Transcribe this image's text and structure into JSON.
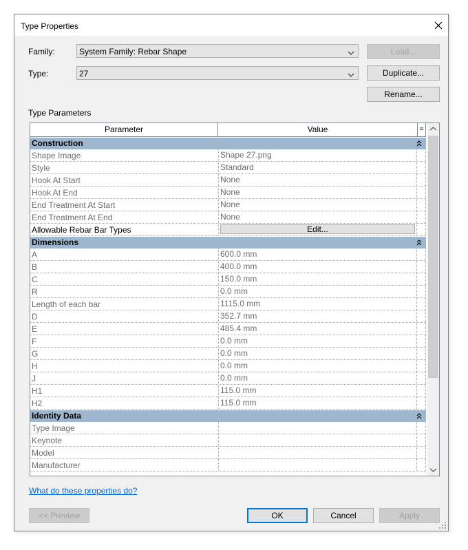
{
  "dialog": {
    "title": "Type Properties"
  },
  "family": {
    "label": "Family:",
    "value": "System Family: Rebar Shape"
  },
  "type": {
    "label": "Type:",
    "value": "27"
  },
  "buttons": {
    "load": "Load...",
    "duplicate": "Duplicate...",
    "rename": "Rename...",
    "preview": "<< Preview",
    "ok": "OK",
    "cancel": "Cancel",
    "apply": "Apply"
  },
  "section_label": "Type Parameters",
  "table": {
    "headers": {
      "parameter": "Parameter",
      "value": "Value",
      "eq": "="
    },
    "groups": [
      {
        "name": "Construction",
        "rows": [
          {
            "parameter": "Shape Image",
            "value": "Shape 27.png"
          },
          {
            "parameter": "Style",
            "value": "Standard"
          },
          {
            "parameter": "Hook At Start",
            "value": "None"
          },
          {
            "parameter": "Hook At End",
            "value": "None"
          },
          {
            "parameter": "End Treatment At Start",
            "value": "None"
          },
          {
            "parameter": "End Treatment At End",
            "value": "None"
          },
          {
            "parameter": "Allowable Rebar Bar Types",
            "value": "Edit...",
            "button": true
          }
        ]
      },
      {
        "name": "Dimensions",
        "rows": [
          {
            "parameter": "A",
            "value": "600.0 mm"
          },
          {
            "parameter": "B",
            "value": "400.0 mm"
          },
          {
            "parameter": "C",
            "value": "150.0 mm"
          },
          {
            "parameter": "R",
            "value": "0.0 mm"
          },
          {
            "parameter": "Length of each bar",
            "value": "1115.0 mm"
          },
          {
            "parameter": "D",
            "value": "352.7 mm"
          },
          {
            "parameter": "E",
            "value": "485.4 mm"
          },
          {
            "parameter": "F",
            "value": "0.0 mm"
          },
          {
            "parameter": "G",
            "value": "0.0 mm"
          },
          {
            "parameter": "H",
            "value": "0.0 mm"
          },
          {
            "parameter": "J",
            "value": "0.0 mm"
          },
          {
            "parameter": "H1",
            "value": "115.0 mm"
          },
          {
            "parameter": "H2",
            "value": "115.0 mm"
          }
        ]
      },
      {
        "name": "Identity Data",
        "rows": [
          {
            "parameter": "Type Image",
            "value": ""
          },
          {
            "parameter": "Keynote",
            "value": ""
          },
          {
            "parameter": "Model",
            "value": ""
          },
          {
            "parameter": "Manufacturer",
            "value": ""
          }
        ]
      }
    ]
  },
  "help_link": "What do these properties do?",
  "icons": {
    "close": "close-icon",
    "dropdown": "chevron-down-icon",
    "collapse": "double-chevron-up-icon",
    "scroll_up": "scroll-up-arrow-icon",
    "scroll_down": "scroll-down-arrow-icon",
    "resize": "resize-grip-icon"
  },
  "colors": {
    "group_header": "#9fb6cf",
    "link": "#0066cc",
    "default_button_border": "#0078d7"
  }
}
